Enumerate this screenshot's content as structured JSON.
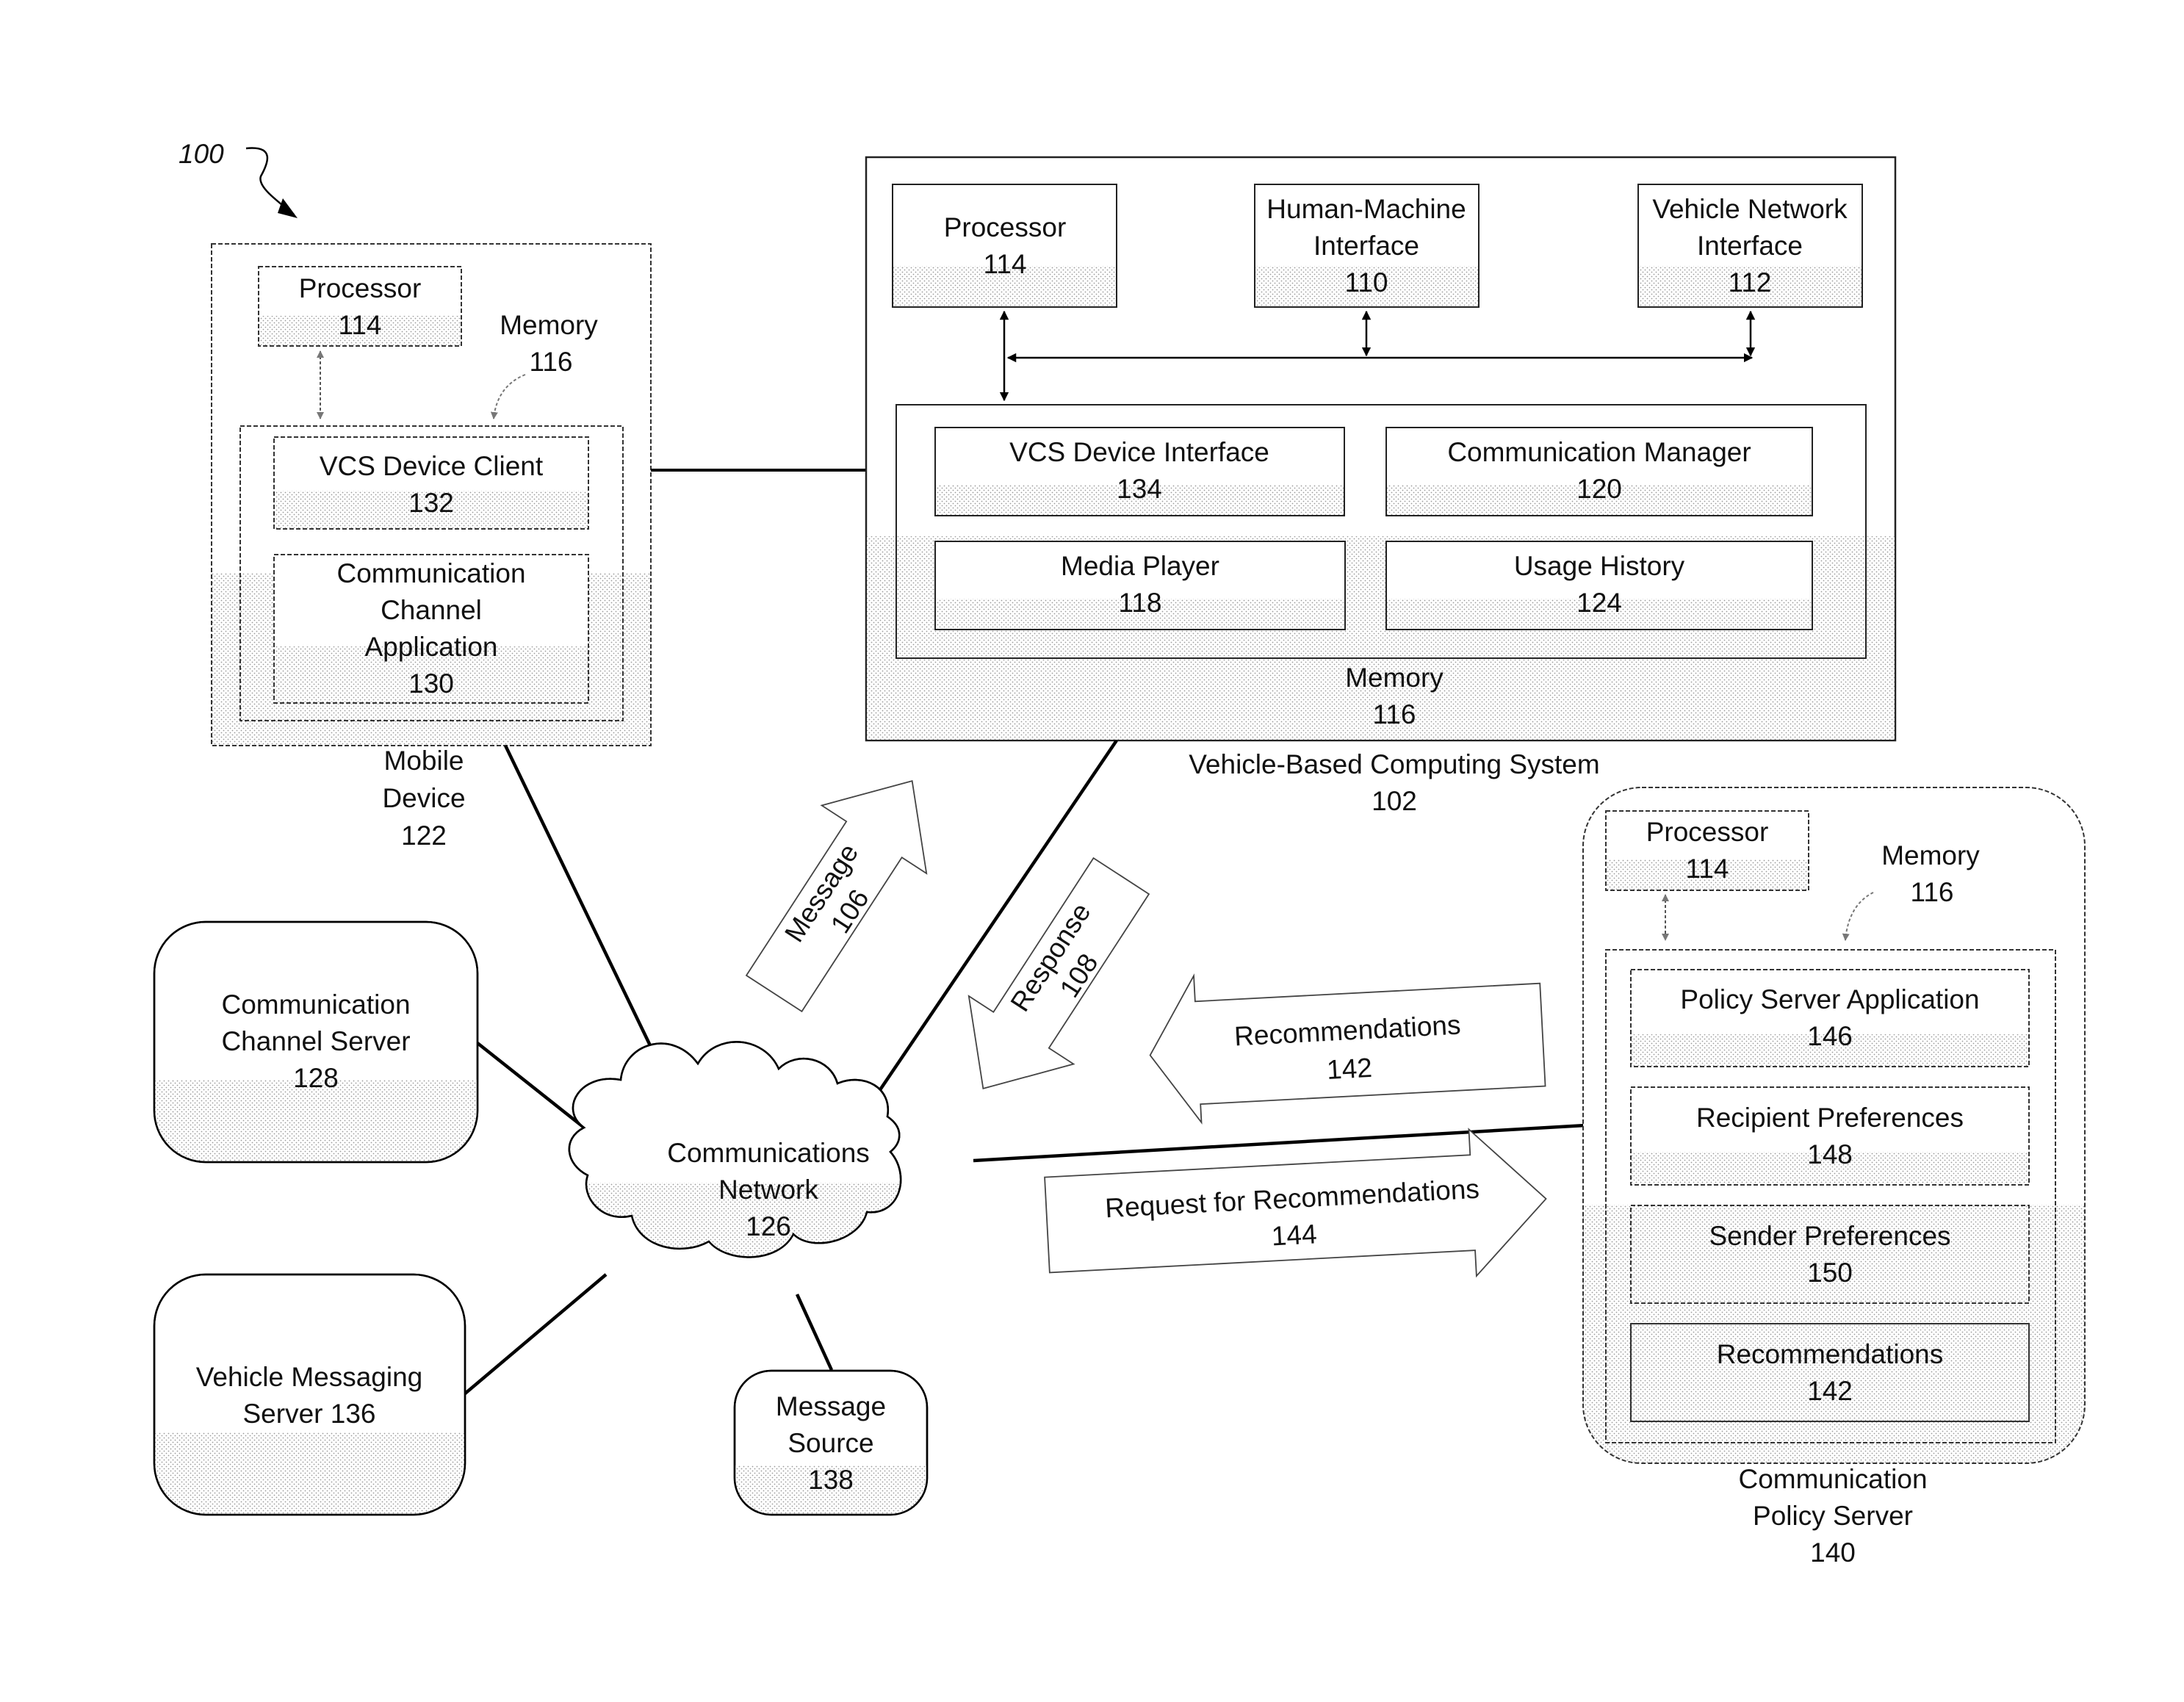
{
  "figure_ref": "100",
  "vcs": {
    "title": "Vehicle-Based Computing System",
    "number": "102",
    "processor": {
      "label": "Processor",
      "number": "114"
    },
    "hmi": {
      "line1": "Human-Machine",
      "line2": "Interface",
      "number": "110"
    },
    "vni": {
      "line1": "Vehicle Network",
      "line2": "Interface",
      "number": "112"
    },
    "memory": {
      "label": "Memory",
      "number": "116"
    },
    "modules": [
      {
        "label": "VCS Device Interface",
        "number": "134"
      },
      {
        "label": "Communication Manager",
        "number": "120"
      },
      {
        "label": "Media Player",
        "number": "118"
      },
      {
        "label": "Usage History",
        "number": "124"
      }
    ]
  },
  "mobile": {
    "line1": "Mobile",
    "line2": "Device",
    "number": "122",
    "processor": {
      "label": "Processor",
      "number": "114"
    },
    "memory": {
      "label": "Memory",
      "number": "116"
    },
    "client": {
      "label": "VCS Device Client",
      "number": "132"
    },
    "app": {
      "line1": "Communication",
      "line2": "Channel",
      "line3": "Application",
      "number": "130"
    }
  },
  "channel_server": {
    "line1": "Communication",
    "line2": "Channel Server",
    "number": "128"
  },
  "vms": {
    "line1": "Vehicle Messaging",
    "line2": "Server 136"
  },
  "message_source": {
    "line1": "Message",
    "line2": "Source",
    "number": "138"
  },
  "network": {
    "line1": "Communications",
    "line2": "Network",
    "number": "126"
  },
  "arrows": {
    "message": {
      "label": "Message",
      "number": "106"
    },
    "response": {
      "label": "Response",
      "number": "108"
    },
    "recommendations": {
      "label": "Recommendations",
      "number": "142"
    },
    "request": {
      "label": "Request for Recommendations",
      "number": "144"
    }
  },
  "policy": {
    "line1": "Communication",
    "line2": "Policy Server",
    "number": "140",
    "processor": {
      "label": "Processor",
      "number": "114"
    },
    "memory": {
      "label": "Memory",
      "number": "116"
    },
    "modules": [
      {
        "label": "Policy Server Application",
        "number": "146"
      },
      {
        "label": "Recipient Preferences",
        "number": "148"
      },
      {
        "label": "Sender Preferences",
        "number": "150"
      },
      {
        "label": "Recommendations",
        "number": "142"
      }
    ]
  }
}
